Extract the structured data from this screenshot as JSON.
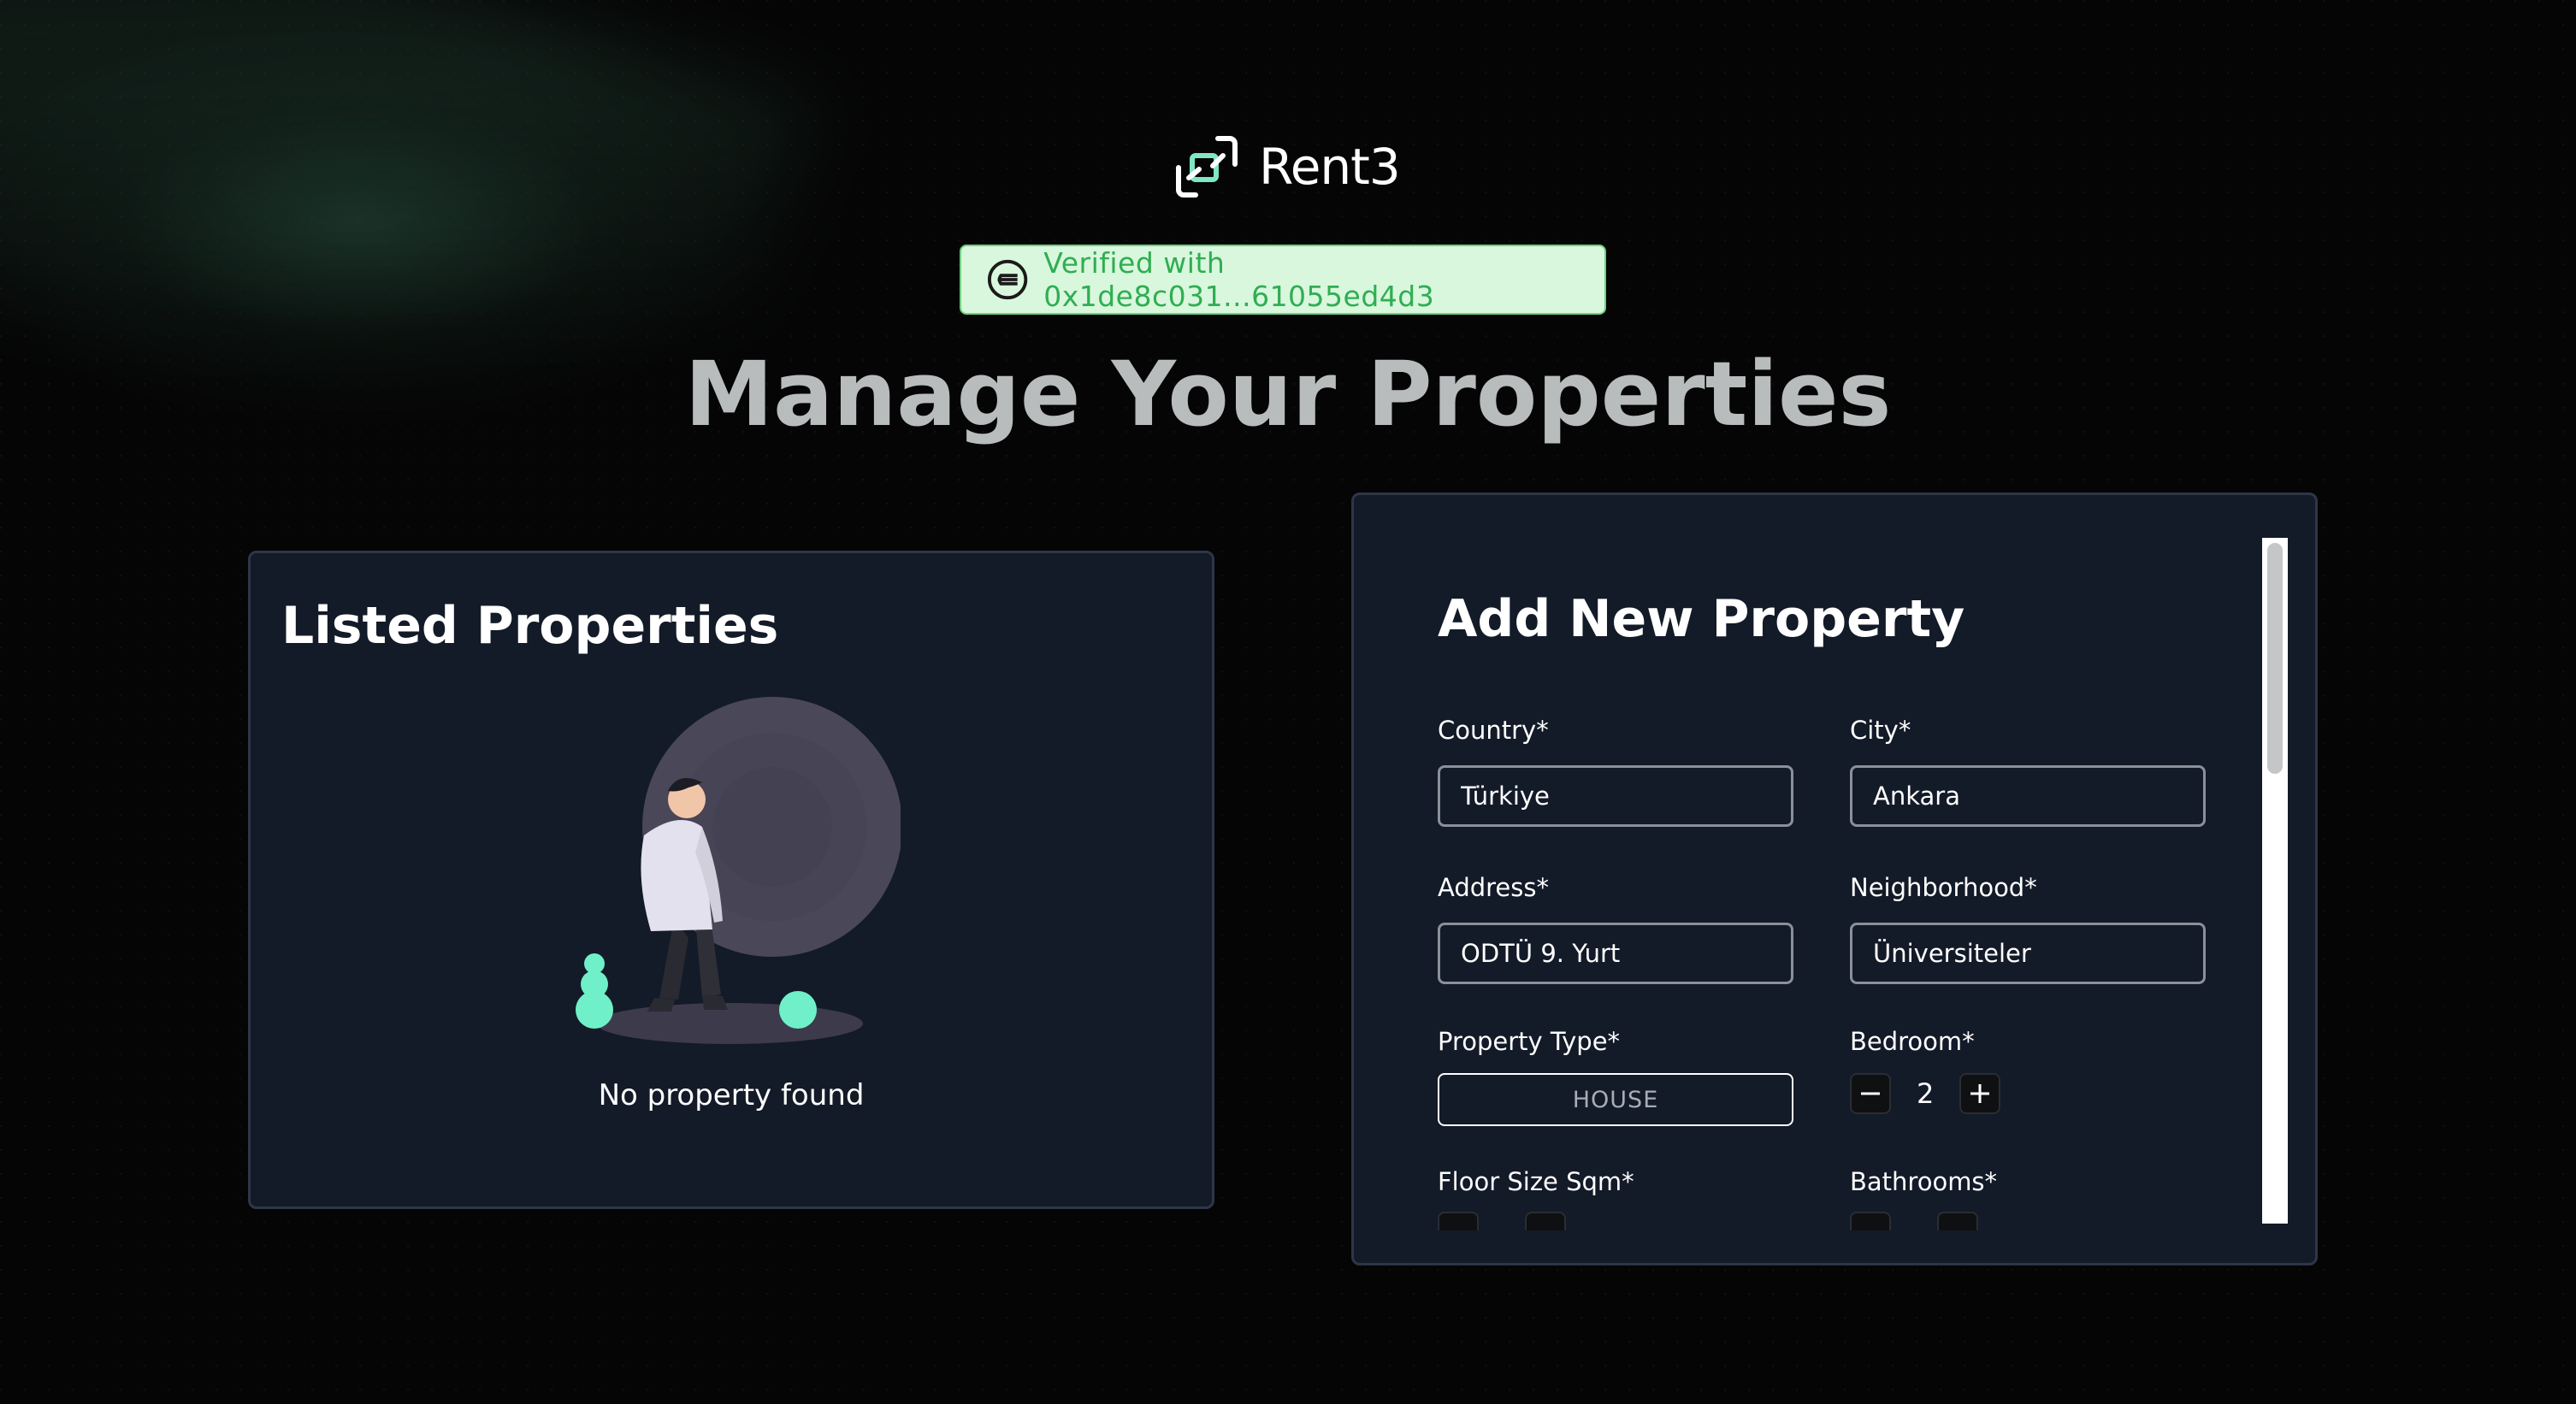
{
  "brand": {
    "name": "Rent3",
    "accent": "#7fe7c4"
  },
  "verification": {
    "text": "Verified with 0x1de8c031...61055ed4d3",
    "bg": "#d9f7dd",
    "color": "#2fae52"
  },
  "page": {
    "title": "Manage Your Properties"
  },
  "listed": {
    "title": "Listed Properties",
    "empty_message": "No property found"
  },
  "add_form": {
    "title": "Add New Property",
    "country": {
      "label": "Country*",
      "value": "Türkiye"
    },
    "city": {
      "label": "City*",
      "value": "Ankara"
    },
    "address": {
      "label": "Address*",
      "value": "ODTÜ 9. Yurt"
    },
    "neighborhood": {
      "label": "Neighborhood*",
      "value": "Üniversiteler"
    },
    "property_type": {
      "label": "Property Type*",
      "value": "HOUSE"
    },
    "bedroom": {
      "label": "Bedroom*",
      "value": "2"
    },
    "floor_size": {
      "label": "Floor Size Sqm*"
    },
    "bathrooms": {
      "label": "Bathrooms*"
    }
  },
  "icons": {
    "brand": "rent3-logo-icon",
    "verify": "worldcoin-icon",
    "minus": "minus-icon",
    "plus": "plus-icon"
  }
}
